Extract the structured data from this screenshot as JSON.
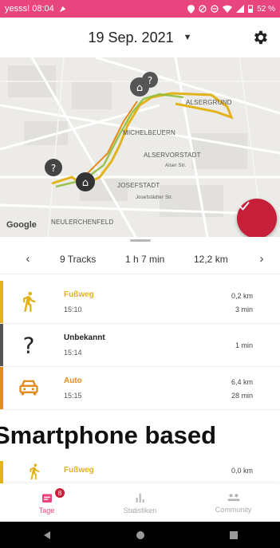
{
  "status_bar": {
    "carrier_time": "yesss! 08:04",
    "battery": "52 %"
  },
  "header": {
    "date": "19 Sep. 2021"
  },
  "map": {
    "labels": {
      "alsergrund": "ALSERGRUND",
      "michelbeuern": "MICHELBEUERN",
      "alservorstadt": "ALSERVORSTADT",
      "josefstadt": "JOSEFSTADT",
      "neulerchenfeld": "NEULERCHENFELD",
      "street1": "Alser Str.",
      "street2": "Josefstädter Str."
    },
    "google": "Google"
  },
  "summary": {
    "tracks": "9 Tracks",
    "duration": "1 h 7 min",
    "distance": "12,2 km"
  },
  "items": [
    {
      "title": "Fußweg",
      "time": "15:10",
      "distance": "0,2 km",
      "duration": "3 min",
      "color": "#e3b31c"
    },
    {
      "title": "Unbekannt",
      "time": "15:14",
      "duration": "1 min",
      "color": "#555555"
    },
    {
      "title": "Auto",
      "time": "15:15",
      "distance": "6,4 km",
      "duration": "28 min",
      "color": "#e38b1c"
    }
  ],
  "caption": "Smartphone based",
  "partial_item": {
    "title": "Fußweg",
    "distance": "0,0 km"
  },
  "bottom_nav": {
    "tage": "Tage",
    "badge": "8",
    "statistiken": "Statistiken",
    "community": "Community"
  },
  "colors": {
    "accent": "#e8457f",
    "fab": "#c61f39",
    "walk": "#e3b31c",
    "unknown": "#555555",
    "car": "#e38b1c"
  }
}
